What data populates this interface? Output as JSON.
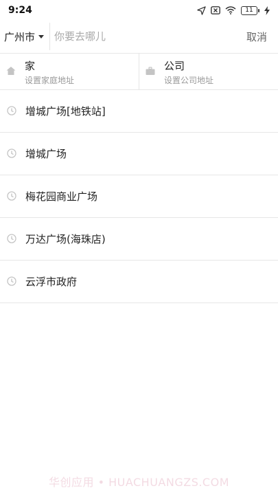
{
  "status_bar": {
    "time": "9:24",
    "battery_level": "11",
    "icons": [
      "location-arrow-icon",
      "sim-off-icon",
      "wifi-icon",
      "battery-icon",
      "charging-bolt-icon"
    ]
  },
  "search": {
    "city": "广州市",
    "placeholder": "你要去哪儿",
    "value": "",
    "cancel_label": "取消"
  },
  "shortcuts": [
    {
      "title": "家",
      "subtitle": "设置家庭地址",
      "icon": "home-icon"
    },
    {
      "title": "公司",
      "subtitle": "设置公司地址",
      "icon": "briefcase-icon"
    }
  ],
  "history": [
    {
      "label": "增城广场[地铁站]",
      "icon": "clock-icon"
    },
    {
      "label": "增城广场",
      "icon": "clock-icon"
    },
    {
      "label": "梅花园商业广场",
      "icon": "clock-icon"
    },
    {
      "label": "万达广场(海珠店)",
      "icon": "clock-icon"
    },
    {
      "label": "云浮市政府",
      "icon": "clock-icon"
    }
  ],
  "watermark": "华创应用 • HUACHUANGZS.COM",
  "colors": {
    "text": "#222222",
    "muted": "#9a9a9a",
    "divider": "#e6e6e6",
    "watermark": "#f3dbe3"
  }
}
